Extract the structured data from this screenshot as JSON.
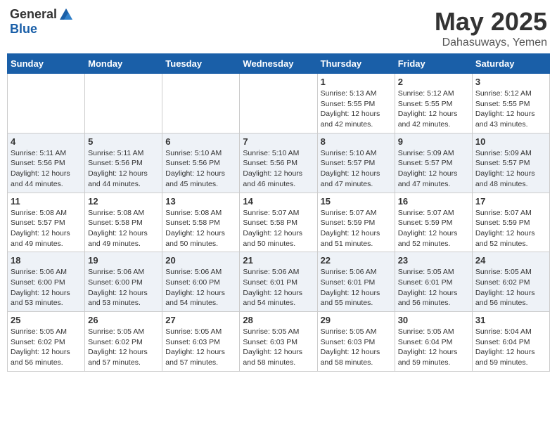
{
  "logo": {
    "general": "General",
    "blue": "Blue"
  },
  "title": {
    "month_year": "May 2025",
    "location": "Dahasuways, Yemen"
  },
  "weekdays": [
    "Sunday",
    "Monday",
    "Tuesday",
    "Wednesday",
    "Thursday",
    "Friday",
    "Saturday"
  ],
  "weeks": [
    [
      {
        "day": "",
        "info": ""
      },
      {
        "day": "",
        "info": ""
      },
      {
        "day": "",
        "info": ""
      },
      {
        "day": "",
        "info": ""
      },
      {
        "day": "1",
        "info": "Sunrise: 5:13 AM\nSunset: 5:55 PM\nDaylight: 12 hours\nand 42 minutes."
      },
      {
        "day": "2",
        "info": "Sunrise: 5:12 AM\nSunset: 5:55 PM\nDaylight: 12 hours\nand 42 minutes."
      },
      {
        "day": "3",
        "info": "Sunrise: 5:12 AM\nSunset: 5:55 PM\nDaylight: 12 hours\nand 43 minutes."
      }
    ],
    [
      {
        "day": "4",
        "info": "Sunrise: 5:11 AM\nSunset: 5:56 PM\nDaylight: 12 hours\nand 44 minutes."
      },
      {
        "day": "5",
        "info": "Sunrise: 5:11 AM\nSunset: 5:56 PM\nDaylight: 12 hours\nand 44 minutes."
      },
      {
        "day": "6",
        "info": "Sunrise: 5:10 AM\nSunset: 5:56 PM\nDaylight: 12 hours\nand 45 minutes."
      },
      {
        "day": "7",
        "info": "Sunrise: 5:10 AM\nSunset: 5:56 PM\nDaylight: 12 hours\nand 46 minutes."
      },
      {
        "day": "8",
        "info": "Sunrise: 5:10 AM\nSunset: 5:57 PM\nDaylight: 12 hours\nand 47 minutes."
      },
      {
        "day": "9",
        "info": "Sunrise: 5:09 AM\nSunset: 5:57 PM\nDaylight: 12 hours\nand 47 minutes."
      },
      {
        "day": "10",
        "info": "Sunrise: 5:09 AM\nSunset: 5:57 PM\nDaylight: 12 hours\nand 48 minutes."
      }
    ],
    [
      {
        "day": "11",
        "info": "Sunrise: 5:08 AM\nSunset: 5:57 PM\nDaylight: 12 hours\nand 49 minutes."
      },
      {
        "day": "12",
        "info": "Sunrise: 5:08 AM\nSunset: 5:58 PM\nDaylight: 12 hours\nand 49 minutes."
      },
      {
        "day": "13",
        "info": "Sunrise: 5:08 AM\nSunset: 5:58 PM\nDaylight: 12 hours\nand 50 minutes."
      },
      {
        "day": "14",
        "info": "Sunrise: 5:07 AM\nSunset: 5:58 PM\nDaylight: 12 hours\nand 50 minutes."
      },
      {
        "day": "15",
        "info": "Sunrise: 5:07 AM\nSunset: 5:59 PM\nDaylight: 12 hours\nand 51 minutes."
      },
      {
        "day": "16",
        "info": "Sunrise: 5:07 AM\nSunset: 5:59 PM\nDaylight: 12 hours\nand 52 minutes."
      },
      {
        "day": "17",
        "info": "Sunrise: 5:07 AM\nSunset: 5:59 PM\nDaylight: 12 hours\nand 52 minutes."
      }
    ],
    [
      {
        "day": "18",
        "info": "Sunrise: 5:06 AM\nSunset: 6:00 PM\nDaylight: 12 hours\nand 53 minutes."
      },
      {
        "day": "19",
        "info": "Sunrise: 5:06 AM\nSunset: 6:00 PM\nDaylight: 12 hours\nand 53 minutes."
      },
      {
        "day": "20",
        "info": "Sunrise: 5:06 AM\nSunset: 6:00 PM\nDaylight: 12 hours\nand 54 minutes."
      },
      {
        "day": "21",
        "info": "Sunrise: 5:06 AM\nSunset: 6:01 PM\nDaylight: 12 hours\nand 54 minutes."
      },
      {
        "day": "22",
        "info": "Sunrise: 5:06 AM\nSunset: 6:01 PM\nDaylight: 12 hours\nand 55 minutes."
      },
      {
        "day": "23",
        "info": "Sunrise: 5:05 AM\nSunset: 6:01 PM\nDaylight: 12 hours\nand 56 minutes."
      },
      {
        "day": "24",
        "info": "Sunrise: 5:05 AM\nSunset: 6:02 PM\nDaylight: 12 hours\nand 56 minutes."
      }
    ],
    [
      {
        "day": "25",
        "info": "Sunrise: 5:05 AM\nSunset: 6:02 PM\nDaylight: 12 hours\nand 56 minutes."
      },
      {
        "day": "26",
        "info": "Sunrise: 5:05 AM\nSunset: 6:02 PM\nDaylight: 12 hours\nand 57 minutes."
      },
      {
        "day": "27",
        "info": "Sunrise: 5:05 AM\nSunset: 6:03 PM\nDaylight: 12 hours\nand 57 minutes."
      },
      {
        "day": "28",
        "info": "Sunrise: 5:05 AM\nSunset: 6:03 PM\nDaylight: 12 hours\nand 58 minutes."
      },
      {
        "day": "29",
        "info": "Sunrise: 5:05 AM\nSunset: 6:03 PM\nDaylight: 12 hours\nand 58 minutes."
      },
      {
        "day": "30",
        "info": "Sunrise: 5:05 AM\nSunset: 6:04 PM\nDaylight: 12 hours\nand 59 minutes."
      },
      {
        "day": "31",
        "info": "Sunrise: 5:04 AM\nSunset: 6:04 PM\nDaylight: 12 hours\nand 59 minutes."
      }
    ]
  ]
}
